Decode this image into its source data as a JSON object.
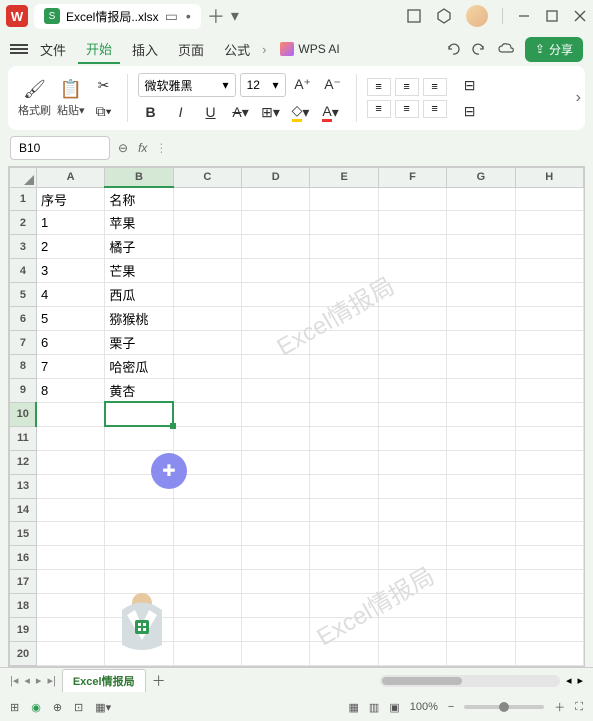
{
  "titlebar": {
    "app_logo": "W",
    "doc_icon": "S",
    "filename": "Excel情报局..xlsx"
  },
  "menubar": {
    "file": "文件",
    "tabs": [
      "开始",
      "插入",
      "页面",
      "公式"
    ],
    "active_tab": "开始",
    "ai_label": "WPS AI",
    "share": "分享"
  },
  "ribbon": {
    "format_painter": "格式刷",
    "paste": "粘贴",
    "font_name": "微软雅黑",
    "font_size": "12",
    "buttons": {
      "bold": "B",
      "italic": "I",
      "underline": "U",
      "strike": "A"
    }
  },
  "formula_bar": {
    "cell_ref": "B10",
    "fx": "fx"
  },
  "sheet": {
    "cols": [
      "A",
      "B",
      "C",
      "D",
      "E",
      "F",
      "G",
      "H"
    ],
    "rows": [
      {
        "n": "1",
        "a": "序号",
        "b": "名称"
      },
      {
        "n": "2",
        "a": "1",
        "b": "苹果"
      },
      {
        "n": "3",
        "a": "2",
        "b": "橘子"
      },
      {
        "n": "4",
        "a": "3",
        "b": "芒果"
      },
      {
        "n": "5",
        "a": "4",
        "b": "西瓜"
      },
      {
        "n": "6",
        "a": "5",
        "b": "猕猴桃"
      },
      {
        "n": "7",
        "a": "6",
        "b": "栗子"
      },
      {
        "n": "8",
        "a": "7",
        "b": "哈密瓜"
      },
      {
        "n": "9",
        "a": "8",
        "b": "黄杏"
      },
      {
        "n": "10",
        "a": "",
        "b": ""
      },
      {
        "n": "11",
        "a": "",
        "b": ""
      },
      {
        "n": "12",
        "a": "",
        "b": ""
      },
      {
        "n": "13",
        "a": "",
        "b": ""
      },
      {
        "n": "14",
        "a": "",
        "b": ""
      },
      {
        "n": "15",
        "a": "",
        "b": ""
      },
      {
        "n": "16",
        "a": "",
        "b": ""
      },
      {
        "n": "17",
        "a": "",
        "b": ""
      },
      {
        "n": "18",
        "a": "",
        "b": ""
      },
      {
        "n": "19",
        "a": "",
        "b": ""
      },
      {
        "n": "20",
        "a": "",
        "b": ""
      }
    ],
    "selected": {
      "row": "10",
      "col": "B"
    },
    "watermark": "Excel情报局"
  },
  "sheet_tabs": {
    "active": "Excel情报局"
  },
  "status": {
    "zoom": "100%"
  }
}
